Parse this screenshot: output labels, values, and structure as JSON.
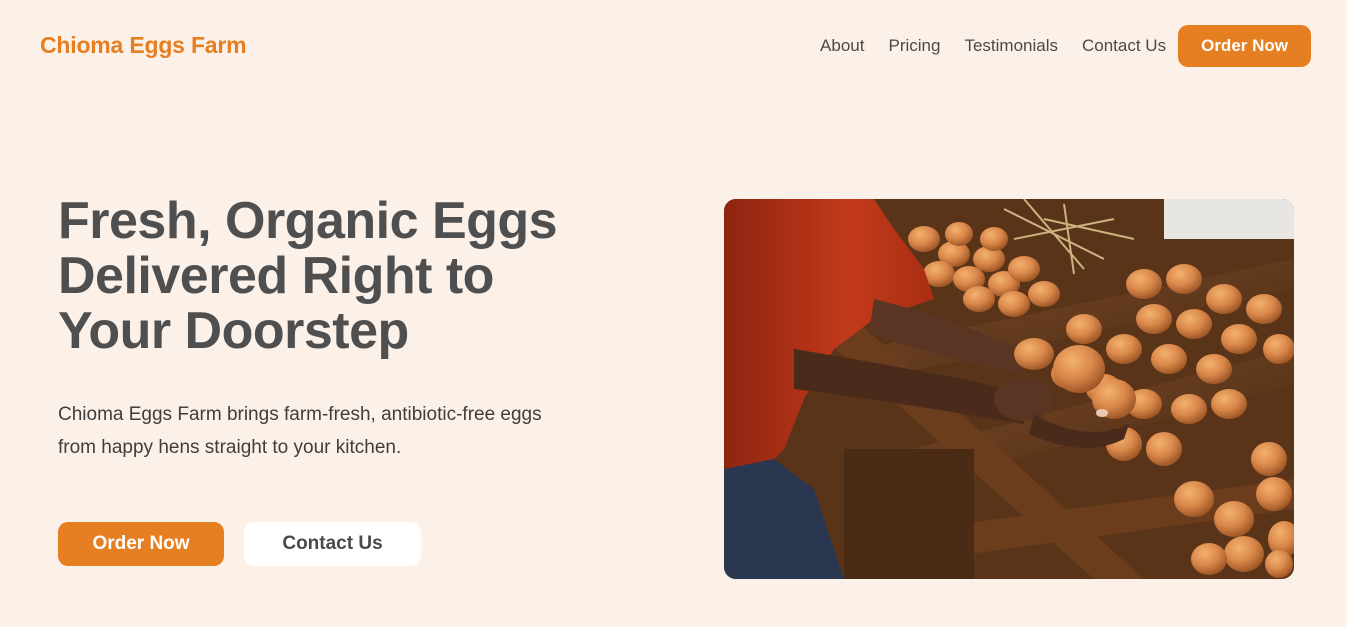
{
  "header": {
    "brand": "Chioma Eggs Farm",
    "nav": [
      "About",
      "Pricing",
      "Testimonials",
      "Contact Us"
    ],
    "cta": "Order Now"
  },
  "hero": {
    "title_lines": [
      "Fresh, Organic Eggs",
      "Delivered Right to",
      "Your Doorstep"
    ],
    "description_lines": [
      "Chioma Eggs Farm brings farm-fresh, antibiotic-free eggs",
      "from happy hens straight to your kitchen."
    ],
    "primary_button": "Order Now",
    "secondary_button": "Contact Us"
  },
  "colors": {
    "background": "#fcf1e8",
    "accent": "#e67e22",
    "heading": "#4f4f4f"
  }
}
